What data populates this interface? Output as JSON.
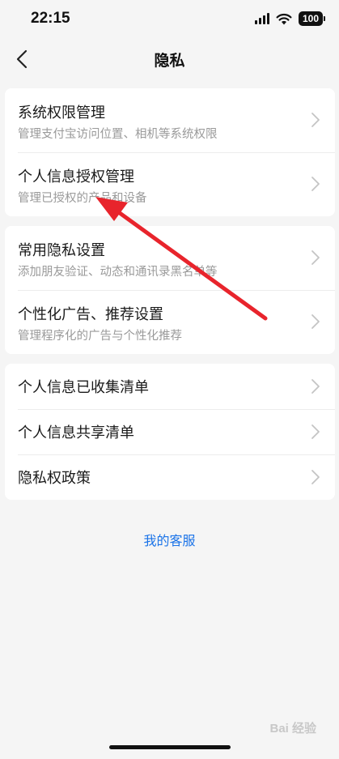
{
  "status_bar": {
    "time": "22:15",
    "battery": "100",
    "icons": [
      "cellular-signal-icon",
      "wifi-icon",
      "battery-icon"
    ]
  },
  "nav": {
    "back_icon": "chevron-left-icon",
    "title": "隐私"
  },
  "groups": [
    {
      "items": [
        {
          "title": "系统权限管理",
          "subtitle": "管理支付宝访问位置、相机等系统权限"
        },
        {
          "title": "个人信息授权管理",
          "subtitle": "管理已授权的产品和设备"
        }
      ]
    },
    {
      "items": [
        {
          "title": "常用隐私设置",
          "subtitle": "添加朋友验证、动态和通讯录黑名单等"
        },
        {
          "title": "个性化广告、推荐设置",
          "subtitle": "管理程序化的广告与个性化推荐"
        }
      ]
    },
    {
      "items": [
        {
          "title": "个人信息已收集清单"
        },
        {
          "title": "个人信息共享清单"
        },
        {
          "title": "隐私权政策"
        }
      ]
    }
  ],
  "footer": {
    "service_link": "我的客服"
  },
  "watermark": "Bai 经验",
  "colors": {
    "background": "#f5f5f5",
    "link": "#1a73e8",
    "annotation_arrow": "#e8242c",
    "subtitle": "#9a9a9a"
  }
}
